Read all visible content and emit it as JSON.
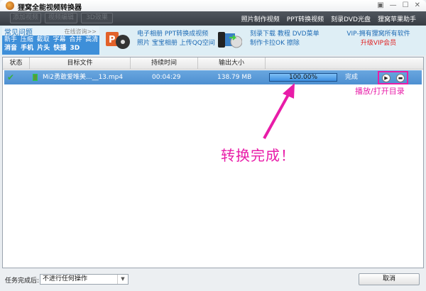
{
  "window": {
    "title": "狸窝全能视频转换器"
  },
  "toolbar": {
    "buttons": [
      "添加视频",
      "视频编辑",
      "3D效果"
    ],
    "links": [
      "照片制作视频",
      "PPT转换视频",
      "刻录DVD光盘",
      "狸窝苹果助手"
    ]
  },
  "faq": {
    "heading": "常见问题",
    "consult": "在线咨询>>",
    "line1": "新手 压缩 截取 字幕 合并 高清",
    "line2": "消音 手机 片头 快播 3D"
  },
  "promo1": {
    "line1": "电子相册 PPT转换成视频",
    "line2": "照片 宝宝相册 上传QQ空间"
  },
  "promo2": {
    "line1": "刻录下载 教程 DVD菜单",
    "line2": "制作卡拉OK 擦除"
  },
  "vip": {
    "line1": "VIP-拥有狸窝所有软件",
    "line2": "升级VIP会员"
  },
  "table": {
    "headers": [
      "状态",
      "目标文件",
      "持续时间",
      "输出大小",
      ""
    ],
    "rows": [
      {
        "file": "Mi2勇敢爱唯美...__13.mp4",
        "duration": "00:04:29",
        "size": "138.79 MB",
        "progress_text": "100.00%",
        "progress": 100,
        "status": "完成"
      }
    ]
  },
  "annotations": {
    "actions": "播放/打开目录",
    "done": "转换完成！"
  },
  "footer": {
    "label": "任务完成后:",
    "select_value": "不进行任何操作",
    "cancel": "取消"
  },
  "colors": {
    "accent": "#e81ca8",
    "row": "#4d8fd1"
  }
}
